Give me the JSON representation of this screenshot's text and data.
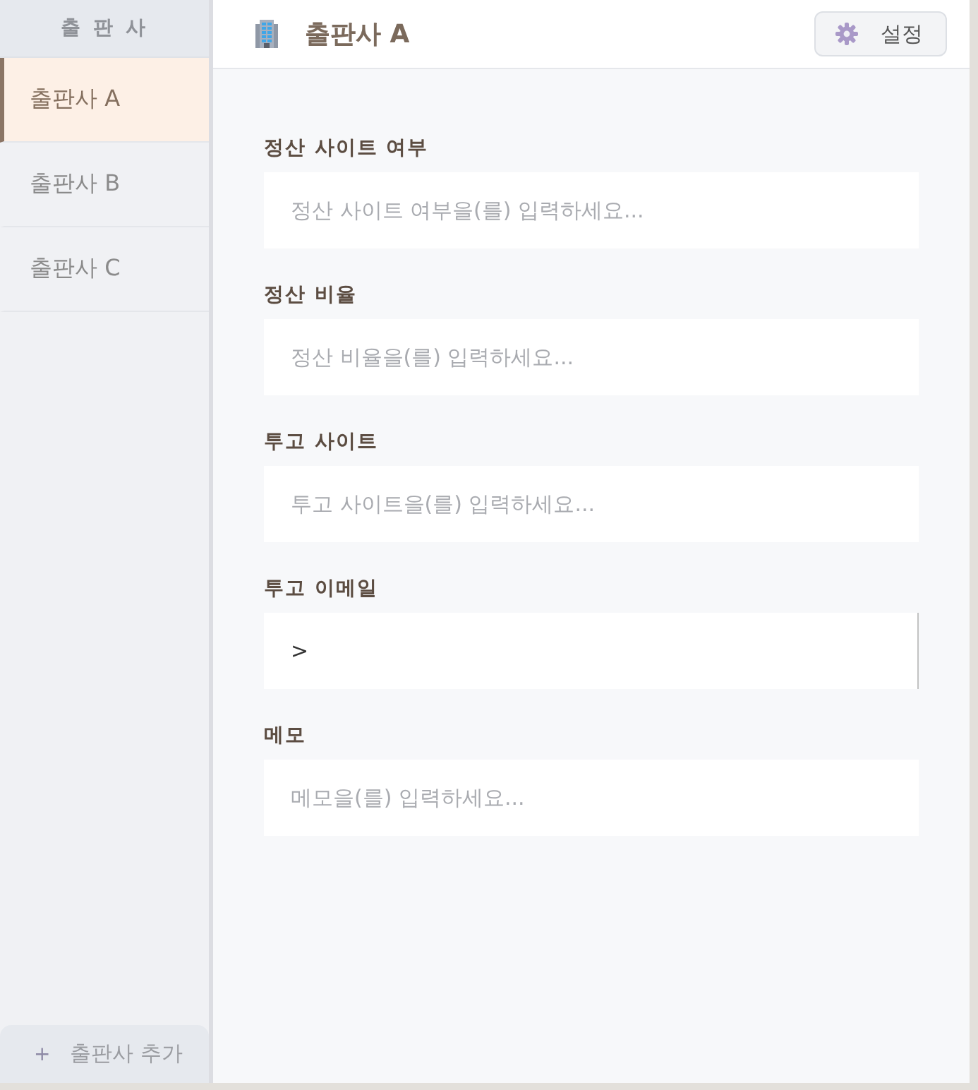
{
  "sidebar": {
    "title": "출 판 사",
    "items": [
      {
        "label": "출판사 A",
        "selected": true
      },
      {
        "label": "출판사 B",
        "selected": false
      },
      {
        "label": "출판사 C",
        "selected": false
      }
    ],
    "add_button": {
      "icon": "+",
      "label": "출판사 추가"
    }
  },
  "header": {
    "title": "출판사 A",
    "settings_button": "설정"
  },
  "form": {
    "fields": [
      {
        "label": "정산 사이트 여부",
        "placeholder": "정산 사이트 여부을(를) 입력하세요...",
        "focused": false
      },
      {
        "label": "정산 비율",
        "placeholder": "정산 비율을(를) 입력하세요...",
        "focused": false
      },
      {
        "label": "투고 사이트",
        "placeholder": "투고 사이트을(를) 입력하세요...",
        "focused": false
      },
      {
        "label": "투고 이메일",
        "value": ">",
        "focused": true
      },
      {
        "label": "메모",
        "placeholder": "메모을(를) 입력하세요...",
        "focused": false
      }
    ]
  }
}
